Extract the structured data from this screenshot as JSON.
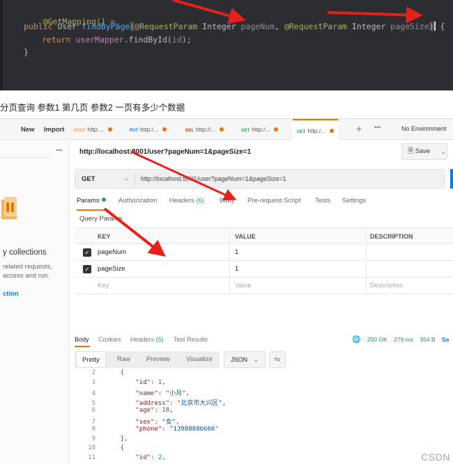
{
  "code": {
    "annotation": "@GetMapping()",
    "line2": {
      "public": "public ",
      "type": "User ",
      "method": "findByPage",
      "open": "(",
      "ann1": "@RequestParam",
      "int1": " Integer ",
      "p1": "pageNum",
      "comma": ", ",
      "ann2": "@RequestParam",
      "int2": " Integer ",
      "p2": "pageSize",
      "close": ")",
      "brace": " {"
    },
    "line3": {
      "ret": "return ",
      "field": "userMapper",
      "call": ".findById(",
      "arg": "id",
      "end": ");"
    },
    "line4": "}"
  },
  "caption": "分页查询 参数1 第几页 参数2 一页有多少个数据",
  "topbar": {
    "new": "New",
    "import": "Import",
    "tabs": [
      {
        "method": "POST",
        "label": "http:..."
      },
      {
        "method": "PUT",
        "label": "http:/..."
      },
      {
        "method": "DEL",
        "label": "http://..."
      },
      {
        "method": "GET",
        "label": "http:/..."
      },
      {
        "method": "GET",
        "label": "http:/..."
      }
    ],
    "plus": "+",
    "more": "•••",
    "environment": "No Environment"
  },
  "sidebar": {
    "more": "•••",
    "collections": "y collections",
    "desc": "related requests, access and run.",
    "action": "ction"
  },
  "request": {
    "title": "http://localhost:8001/user?pageNum=1&pageSize=1",
    "save": "Save",
    "method": "GET",
    "url": "http://localhost:8001/user?pageNum=1&pageSize=1",
    "tabs": {
      "params": "Params",
      "auth": "Authorization",
      "headers": "Headers",
      "headers_count": "(6)",
      "body": "Body",
      "prerequest": "Pre-request Script",
      "tests": "Tests",
      "settings": "Settings"
    },
    "query_label": "Query Params",
    "columns": {
      "key": "KEY",
      "value": "VALUE",
      "desc": "DESCRIPTION"
    },
    "params": [
      {
        "key": "pageNum",
        "value": "1"
      },
      {
        "key": "pageSize",
        "value": "1"
      }
    ],
    "placeholder": {
      "key": "Key",
      "value": "Value",
      "desc": "Description"
    }
  },
  "response": {
    "tabs": {
      "body": "Body",
      "cookies": "Cookies",
      "headers": "Headers",
      "headers_count": "(5)",
      "tests": "Test Results"
    },
    "status": "200 OK",
    "time": "279 ms",
    "size": "354 B",
    "save": "Sa",
    "formats": {
      "pretty": "Pretty",
      "raw": "Raw",
      "preview": "Preview",
      "visualize": "Visualize"
    },
    "json": "JSON",
    "lines": [
      {
        "n": "2",
        "t": "    {"
      },
      {
        "n": "3",
        "key": "\"id\"",
        "val": "1",
        "kind": "n",
        "end": ","
      },
      {
        "n": "4",
        "key": "\"name\"",
        "val": "\"小月\"",
        "kind": "s",
        "end": ","
      },
      {
        "n": "5",
        "key": "\"address\"",
        "val": "\"北京市大兴区\"",
        "kind": "s",
        "end": ","
      },
      {
        "n": "6",
        "key": "\"age\"",
        "val": "18",
        "kind": "n",
        "end": ","
      },
      {
        "n": "7",
        "key": "\"sex\"",
        "val": "\"女\"",
        "kind": "s",
        "end": ","
      },
      {
        "n": "8",
        "key": "\"phone\"",
        "val": "\"13988886666\"",
        "kind": "s",
        "end": ""
      },
      {
        "n": "9",
        "t": "    },"
      },
      {
        "n": "10",
        "t": "    {"
      },
      {
        "n": "11",
        "key": "\"id\"",
        "val": "2",
        "kind": "n",
        "end": ","
      }
    ]
  },
  "watermark": "CSDN"
}
